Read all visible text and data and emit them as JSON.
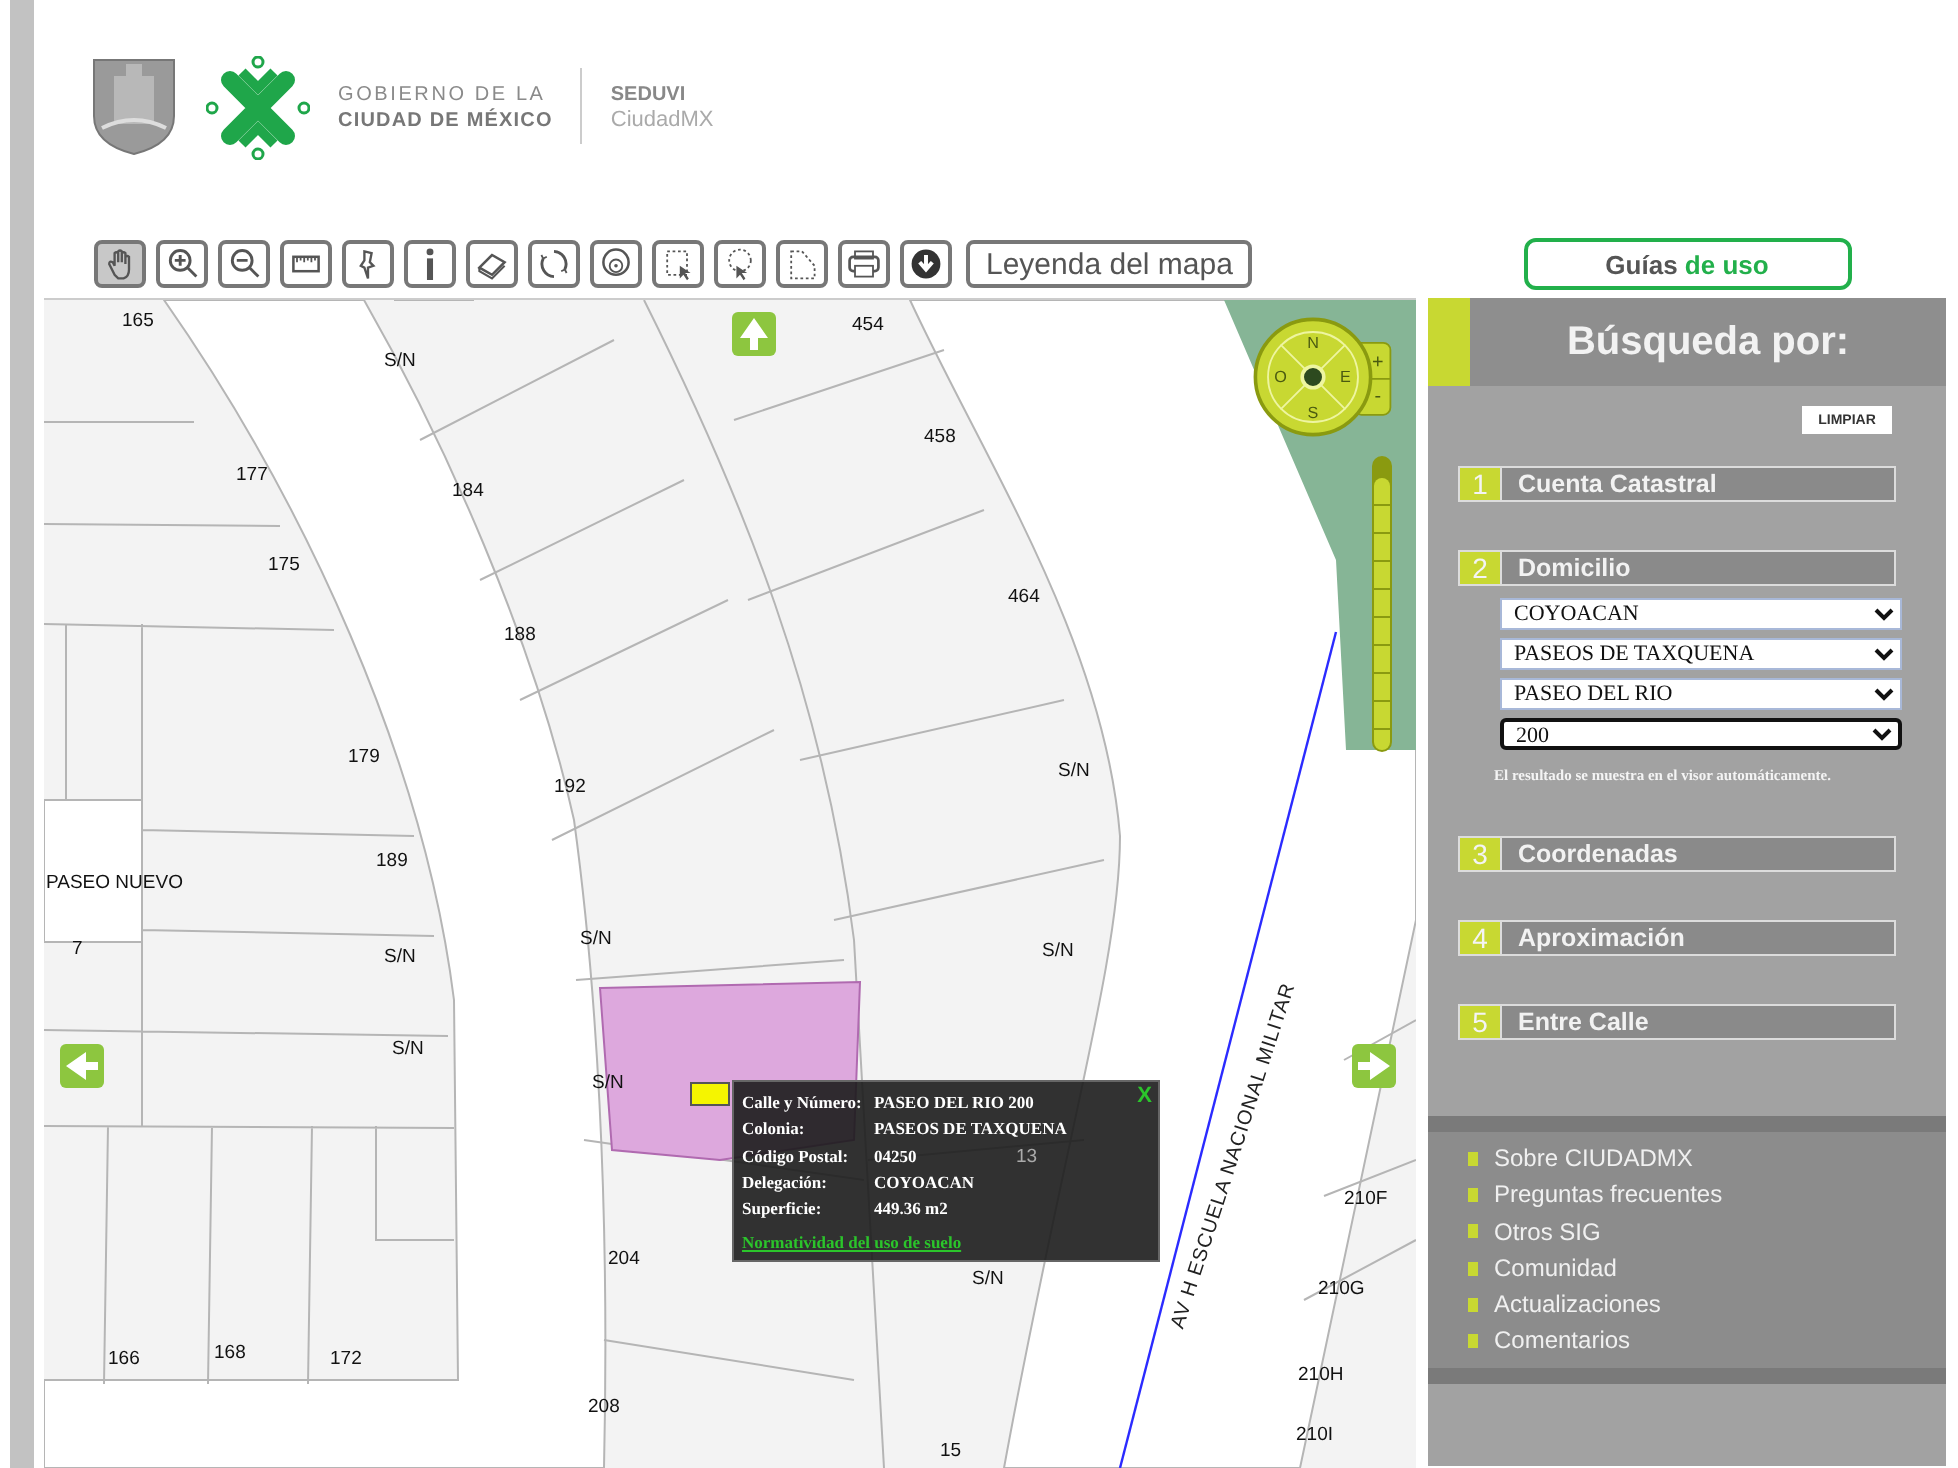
{
  "header": {
    "gov_line1": "GOBIERNO DE LA",
    "gov_line2": "CIUDAD DE MÉXICO",
    "agency": "SEDUVI",
    "agency_sub": "CiudadMX"
  },
  "toolbar": {
    "tools": [
      {
        "kind": "pan",
        "selected": true
      },
      {
        "kind": "zoom-in",
        "selected": false
      },
      {
        "kind": "zoom-out",
        "selected": false
      },
      {
        "kind": "ruler",
        "selected": false
      },
      {
        "kind": "pin",
        "selected": false
      },
      {
        "kind": "info",
        "selected": false
      },
      {
        "kind": "eraser",
        "selected": false
      },
      {
        "kind": "refresh",
        "selected": false
      },
      {
        "kind": "buffer",
        "selected": false
      },
      {
        "kind": "rect-select",
        "selected": false
      },
      {
        "kind": "circle-select",
        "selected": false
      },
      {
        "kind": "poly-select",
        "selected": false
      },
      {
        "kind": "print",
        "selected": false
      },
      {
        "kind": "download",
        "selected": false
      }
    ],
    "legend_button": "Leyenda del mapa"
  },
  "guides_button": {
    "label": "Guías",
    "accent": "de uso"
  },
  "map": {
    "labels": [
      "165",
      "S/N",
      "454",
      "177",
      "184",
      "458",
      "175",
      "464",
      "188",
      "179",
      "192",
      "S/N",
      "189",
      "PASEO NUEVO",
      "7",
      "S/N",
      "S/N",
      "S/N",
      "S/N",
      "S/N",
      "13",
      "210F",
      "204",
      "S/N",
      "210G",
      "166",
      "168",
      "172",
      "210H",
      "208",
      "15",
      "210I",
      "AV H ESCUELA NACIONAL MILITAR"
    ],
    "compass": {
      "north": "N",
      "east": "E",
      "south": "S",
      "west": "O"
    },
    "zoom_in": "+",
    "zoom_out": "-",
    "zoom_slider": {
      "level": 0.93
    },
    "popup": {
      "close": "X",
      "rows": [
        {
          "label": "Calle y Número:",
          "value": "PASEO DEL RIO 200"
        },
        {
          "label": "Colonia:",
          "value": "PASEOS DE TAXQUENA"
        },
        {
          "label": "Código Postal:",
          "value": "04250"
        },
        {
          "label": "Delegación:",
          "value": "COYOACAN"
        },
        {
          "label": "Superficie:",
          "value": "449.36 m2"
        }
      ],
      "link": "Normatividad del uso de suelo"
    }
  },
  "search_panel": {
    "title": "Búsqueda por:",
    "clear_button": "LIMPIAR",
    "sections": [
      {
        "number": "1",
        "label": "Cuenta Catastral"
      },
      {
        "number": "2",
        "label": "Domicilio",
        "fields": [
          {
            "value": "COYOACAN",
            "focused": false
          },
          {
            "value": "PASEOS DE TAXQUENA",
            "focused": false
          },
          {
            "value": "PASEO DEL RIO",
            "focused": false
          },
          {
            "value": "200",
            "focused": true
          }
        ],
        "note": "El resultado se muestra en el visor automáticamente."
      },
      {
        "number": "3",
        "label": "Coordenadas"
      },
      {
        "number": "4",
        "label": "Aproximación"
      },
      {
        "number": "5",
        "label": "Entre Calle"
      }
    ]
  },
  "links": [
    "Sobre CIUDADMX",
    "Preguntas frecuentes",
    "Otros SIG",
    "Comunidad",
    "Actualizaciones",
    "Comentarios"
  ]
}
